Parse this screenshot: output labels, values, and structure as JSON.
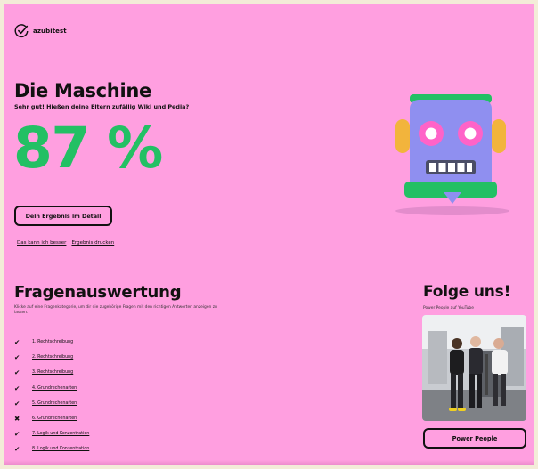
{
  "brand": {
    "name": "azubitest",
    "icon": "check-circle-logo"
  },
  "result": {
    "title": "Die Maschine",
    "subtitle": "Sehr gut! Hießen deine Eltern zufällig Wiki und Pedia?",
    "score": "87 %",
    "detail_button": "Dein Ergebnis im Detail",
    "links": [
      "Das kann ich besser",
      "Ergebnis drucken"
    ]
  },
  "evaluation": {
    "title": "Fragenauswertung",
    "description": "Klicke auf eine Fragenkategorie, um dir die zugehörige Fragen mit den richtigen Antworten anzeigen zu lassen.",
    "items": [
      {
        "status": "correct",
        "label": "1. Rechtschreibung"
      },
      {
        "status": "correct",
        "label": "2. Rechtschreibung"
      },
      {
        "status": "correct",
        "label": "3. Rechtschreibung"
      },
      {
        "status": "correct",
        "label": "4. Grundrechenarten"
      },
      {
        "status": "correct",
        "label": "5. Grundrechenarten"
      },
      {
        "status": "wrong",
        "label": "6. Grundrechenarten"
      },
      {
        "status": "correct",
        "label": "7. Logik und Konzentration"
      },
      {
        "status": "correct",
        "label": "8. Logik und Konzentration"
      }
    ]
  },
  "follow": {
    "title": "Folge uns!",
    "description": "Power People auf YouTube",
    "button": "Power People"
  },
  "colors": {
    "background": "#ff9fe0",
    "score": "#23c064",
    "robot_body": "#8f8ff0",
    "robot_accent": "#23c064",
    "robot_ears": "#f2b43c",
    "robot_eyes": "#ff63c8"
  }
}
